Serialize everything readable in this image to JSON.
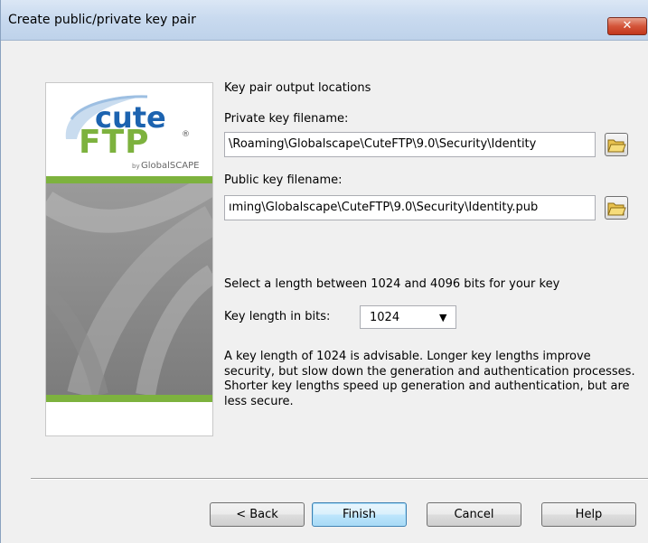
{
  "dialog": {
    "title": "Create public/private key pair",
    "close_glyph": "✕"
  },
  "logo": {
    "brand_top": "cute",
    "brand_bottom": "FTP",
    "registered": "®",
    "by": "by",
    "company": "GlobalSCAPE",
    "colors": {
      "blue": "#1c63b0",
      "green": "#7db23e"
    }
  },
  "form": {
    "section_heading": "Key pair output locations",
    "private_label": "Private key filename:",
    "private_value": "\\Roaming\\Globalscape\\CuteFTP\\9.0\\Security\\Identity",
    "public_label": "Public key filename:",
    "public_value": "ıming\\Globalscape\\CuteFTP\\9.0\\Security\\Identity.pub",
    "browse_icon": "folder-open-icon",
    "length_instruction": "Select a length between 1024 and 4096 bits for your key",
    "key_length_label": "Key length in bits:",
    "key_length_value": "1024",
    "advice": "A key length of 1024 is advisable. Longer key lengths improve security, but slow down the generation and authentication processes.  Shorter key lengths speed up generation and authentication, but are less secure."
  },
  "buttons": {
    "back": "< Back",
    "finish": "Finish",
    "cancel": "Cancel",
    "help": "Help"
  }
}
